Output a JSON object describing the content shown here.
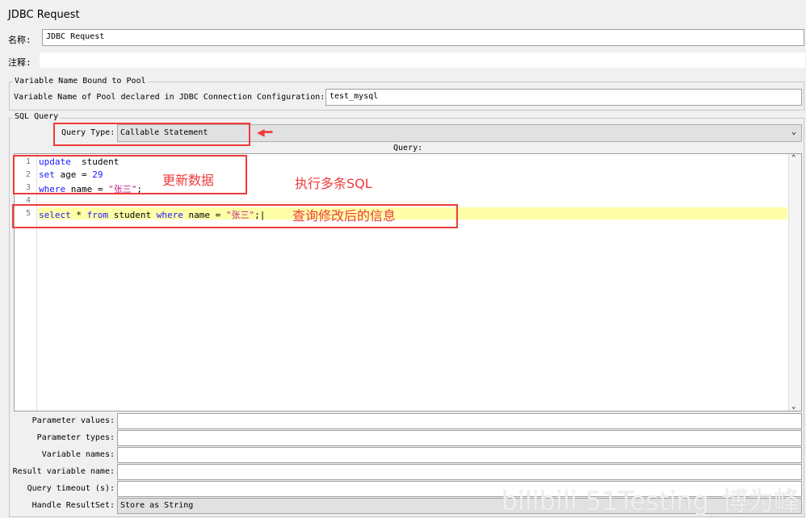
{
  "title": "JDBC Request",
  "name": {
    "label": "名称:",
    "value": "JDBC Request"
  },
  "comment": {
    "label": "注释:",
    "value": ""
  },
  "pool": {
    "legend": "Variable Name Bound to Pool",
    "label": "Variable Name of Pool declared in JDBC Connection Configuration:",
    "value": "test_mysql"
  },
  "sql": {
    "legend": "SQL Query",
    "query_type_label": "Query Type:",
    "query_type_value": "Callable Statement",
    "query_label": "Query:",
    "lines": [
      {
        "n": "1",
        "parts": [
          [
            "kw",
            "update"
          ],
          [
            "",
            "  student"
          ]
        ]
      },
      {
        "n": "2",
        "parts": [
          [
            "kw",
            "set"
          ],
          [
            "",
            " age = "
          ],
          [
            "num",
            "29"
          ]
        ]
      },
      {
        "n": "3",
        "parts": [
          [
            "kw",
            "where"
          ],
          [
            "",
            " name = "
          ],
          [
            "str",
            "\"张三\""
          ],
          [
            "",
            ";"
          ]
        ]
      },
      {
        "n": "4",
        "parts": []
      },
      {
        "n": "5",
        "parts": [
          [
            "kw",
            "select"
          ],
          [
            "",
            " * "
          ],
          [
            "kw",
            "from"
          ],
          [
            "",
            " student "
          ],
          [
            "kw",
            "where"
          ],
          [
            "",
            " name = "
          ],
          [
            "str",
            "\"张三\""
          ],
          [
            "",
            ";"
          ]
        ]
      }
    ]
  },
  "annotations": {
    "update": "更新数据",
    "multi": "执行多条SQL",
    "query": "查询修改后的信息"
  },
  "params": [
    {
      "label": "Parameter values:",
      "value": ""
    },
    {
      "label": "Parameter types:",
      "value": ""
    },
    {
      "label": "Variable names:",
      "value": ""
    },
    {
      "label": "Result variable name:",
      "value": ""
    },
    {
      "label": "Query timeout (s):",
      "value": ""
    },
    {
      "label": "Handle ResultSet:",
      "value": "Store as String"
    }
  ],
  "watermark": "bilibili 51Testing_博为峰",
  "colors": {
    "annotation": "#ef3b3b",
    "keyword": "#1a1aff",
    "string": "#c0208a",
    "current_line": "#ffffa8"
  }
}
